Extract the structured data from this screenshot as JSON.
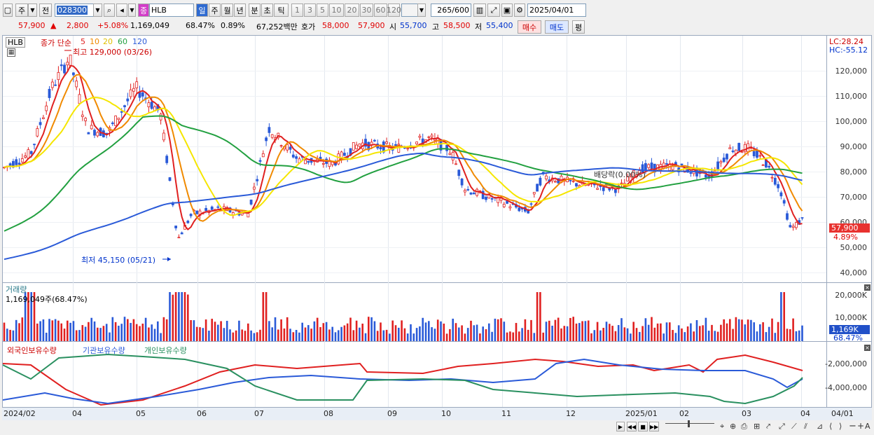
{
  "toolbar": {
    "market_btn": "주",
    "jeon_btn": "전",
    "stock_code": "028300",
    "stock_type_badge": "종",
    "stock_name": "HLB",
    "periods": [
      "일",
      "주",
      "월",
      "년",
      "분",
      "초",
      "틱"
    ],
    "counts": [
      "1",
      "3",
      "5",
      "10",
      "20",
      "30",
      "60",
      "120"
    ],
    "view_count": "265",
    "view_total": "/600",
    "date": "2025/04/01"
  },
  "quote": {
    "price": "57,900",
    "change": "2,800",
    "change_pct": "+5.08%",
    "volume": "1,169,049",
    "vol_ratio": "68.47%",
    "turnover": "0.89%",
    "amount": "67,252백만",
    "hoga_label": "호가",
    "ask": "58,000",
    "bid": "57,900",
    "open_label": "시",
    "open": "55,700",
    "high_label": "고",
    "high": "58,500",
    "low_label": "저",
    "low": "55,400",
    "buy_btn": "매수",
    "sell_btn": "매도",
    "eval_btn": "평"
  },
  "price_pane": {
    "code_label": "HLB",
    "ma_title": "종가 단순",
    "ma_periods": [
      "5",
      "10",
      "20",
      "60",
      "120"
    ],
    "ma_colors": [
      "#e02020",
      "#f08a00",
      "#f5e600",
      "#22a040",
      "#2a5ad8"
    ],
    "lc": "LC:28.24",
    "hc": "HC:-55.12",
    "high_note": "최고 129,000 (03/26)",
    "low_note": "최저 45,150 (05/21)",
    "dividend_note": "배당락(0.00%)",
    "y_ticks": [
      "120,000",
      "110,000",
      "100,000",
      "90,000",
      "80,000",
      "70,000",
      "60,000",
      "50,000",
      "40,000"
    ],
    "last_price": "57,900",
    "last_pct": "4.89%"
  },
  "volume_pane": {
    "title": "거래량",
    "value": "1,169,049주(68.47%)",
    "y_ticks": [
      "20,000K",
      "10,000K"
    ],
    "tag": "1,169K",
    "tag_pct": "68.47%"
  },
  "holding_pane": {
    "series": [
      "외국인보유수량",
      "기관보유수량",
      "개인보유수량"
    ],
    "colors": [
      "#e02020",
      "#2a5ad8",
      "#2a9060"
    ],
    "y_ticks": [
      "-2,000,000",
      "-4,000,000"
    ]
  },
  "x_axis": [
    "2024/02",
    "04",
    "05",
    "06",
    "07",
    "08",
    "09",
    "10",
    "11",
    "12",
    "2025/01",
    "02",
    "03",
    "04",
    "04/01"
  ],
  "chart_data": {
    "type": "line",
    "title": "",
    "xlabel": "",
    "ylabel": "",
    "ylim": [
      38000,
      130000
    ],
    "categories": [
      "2024/02",
      "04",
      "05",
      "06",
      "07",
      "08",
      "09",
      "10",
      "11",
      "12",
      "2025/01",
      "02",
      "03",
      "04"
    ],
    "series": [
      {
        "name": "5",
        "values": [
          78000,
          108000,
          96000,
          60000,
          88000,
          80000,
          86000,
          88000,
          62000,
          74000,
          70000,
          78000,
          85000,
          57900
        ]
      },
      {
        "name": "120",
        "values": [
          42000,
          50000,
          60000,
          72000,
          80000,
          83000,
          84000,
          85000,
          80000,
          77000,
          78000,
          77000,
          77000,
          73000
        ]
      }
    ]
  }
}
